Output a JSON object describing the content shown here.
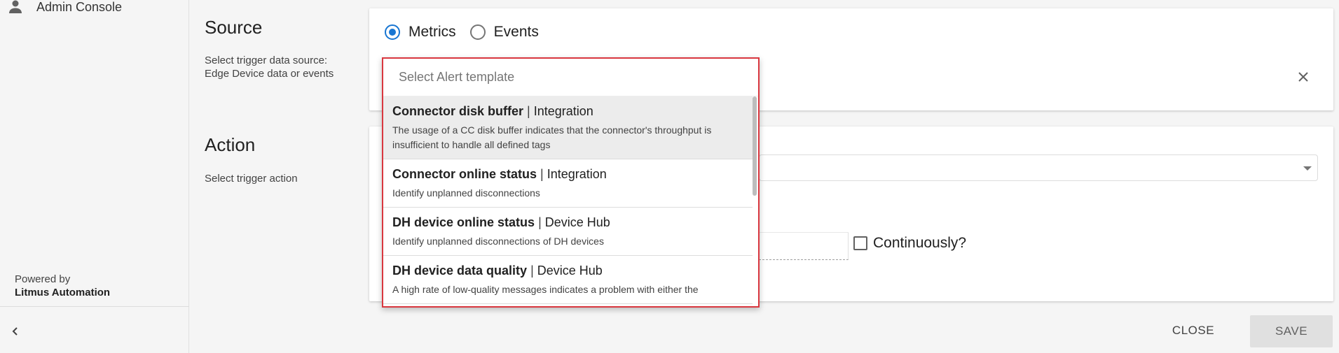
{
  "sidebar": {
    "user_label": "Admin Console",
    "powered_by": "Powered by",
    "brand": "Litmus Automation",
    "collapse_icon": "chevron-left-icon"
  },
  "source": {
    "title": "Source",
    "description_line1": "Select trigger data source:",
    "description_line2": "Edge Device data or events",
    "radio_options": [
      {
        "label": "Metrics",
        "checked": true
      },
      {
        "label": "Events",
        "checked": false
      }
    ]
  },
  "action": {
    "title": "Action",
    "description": "Select trigger action",
    "continuously_label": "Continuously?"
  },
  "dropdown": {
    "placeholder": "Select Alert template",
    "items": [
      {
        "name": "Connector disk buffer",
        "category": "Integration",
        "description": "The usage of a CC disk buffer indicates that the connector's throughput is insufficient to handle all defined tags"
      },
      {
        "name": "Connector online status",
        "category": "Integration",
        "description": "Identify unplanned disconnections"
      },
      {
        "name": "DH device online status",
        "category": "Device Hub",
        "description": "Identify unplanned disconnections of DH devices"
      },
      {
        "name": "DH device data quality",
        "category": "Device Hub",
        "description": "A high rate of low-quality messages indicates a problem with either the"
      }
    ]
  },
  "buttons": {
    "close": "CLOSE",
    "save": "SAVE"
  },
  "colors": {
    "accent": "#1976d2",
    "highlight_border": "#d9373f"
  }
}
